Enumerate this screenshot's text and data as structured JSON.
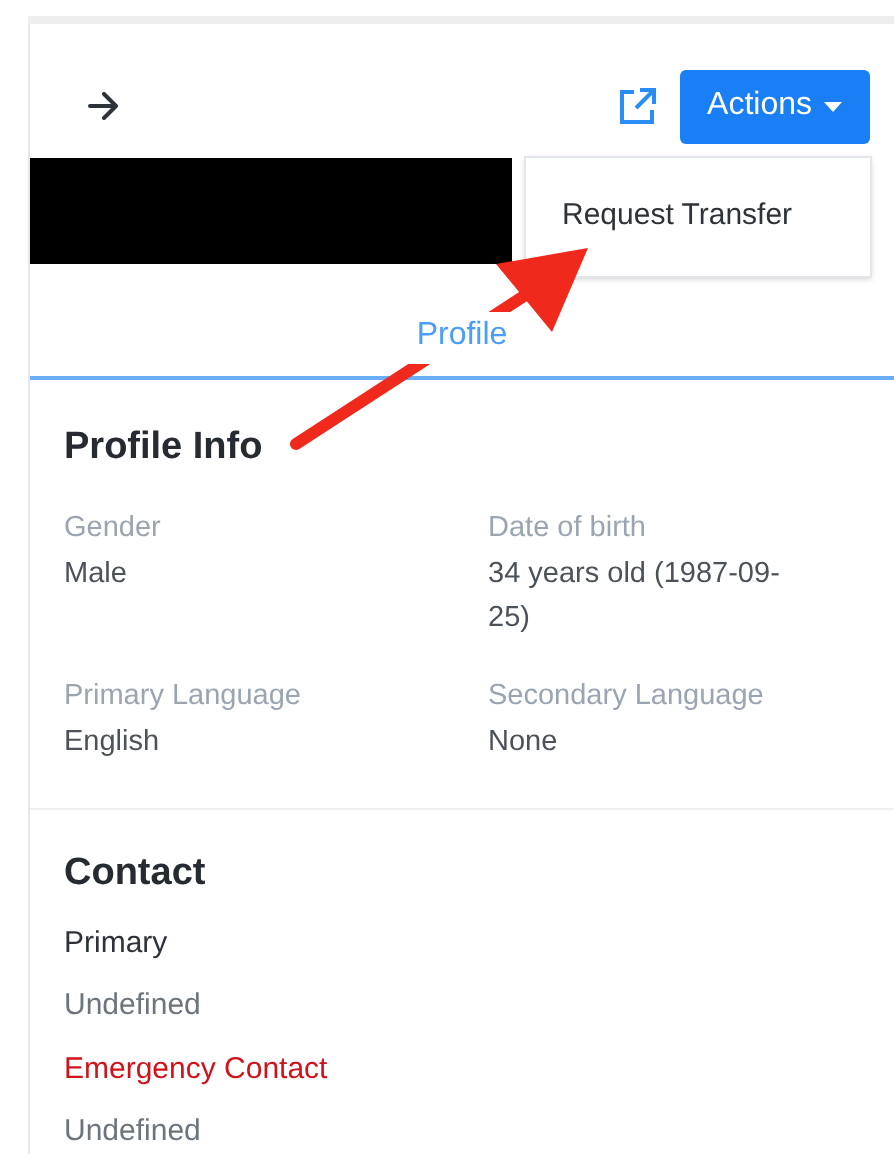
{
  "header": {
    "actions_button": "Actions"
  },
  "dropdown": {
    "items": [
      "Request Transfer"
    ]
  },
  "tabs": [
    {
      "label": "Profile",
      "selected": true
    }
  ],
  "profile_info": {
    "title": "Profile Info",
    "fields": [
      {
        "label": "Gender",
        "value": "Male"
      },
      {
        "label": "Date of birth",
        "value": "34 years old (1987-09-25)"
      },
      {
        "label": "Primary Language",
        "value": "English"
      },
      {
        "label": "Secondary Language",
        "value": "None"
      }
    ]
  },
  "contact": {
    "title": "Contact",
    "entries": [
      {
        "label": "Primary",
        "value": "Undefined",
        "kind": "normal"
      },
      {
        "label": "Emergency Contact",
        "value": "Undefined",
        "kind": "emergency"
      }
    ]
  }
}
